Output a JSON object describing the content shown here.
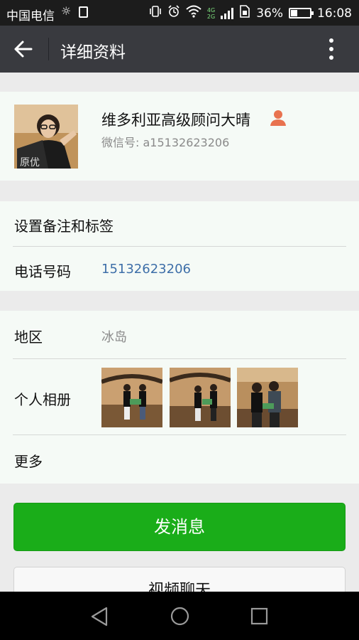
{
  "status_bar": {
    "carrier": "中国电信",
    "net_type_top": "4G",
    "net_type_bottom": "2G",
    "battery_level": 0.36,
    "battery_text": "36%",
    "time": "16:08"
  },
  "header": {
    "title": "详细资料",
    "back_icon": "arrow-left-icon",
    "more_icon": "more-vertical-icon"
  },
  "profile": {
    "nickname": "维多利亚高级顾问大晴",
    "wechat_id_label": "微信号: ",
    "wechat_id": "a15132623206",
    "gender_icon": "person-icon"
  },
  "info": {
    "remark_label": "设置备注和标签",
    "phone_label": "电话号码",
    "phone_value": "15132623206",
    "region_label": "地区",
    "region_value": "冰岛",
    "album_label": "个人相册",
    "more_label": "更多"
  },
  "actions": {
    "send_message": "发消息",
    "video_chat": "视频聊天"
  },
  "colors": {
    "accent_green": "#1aad19",
    "titlebar": "#393a3f",
    "link_blue": "#3d6ea8"
  }
}
